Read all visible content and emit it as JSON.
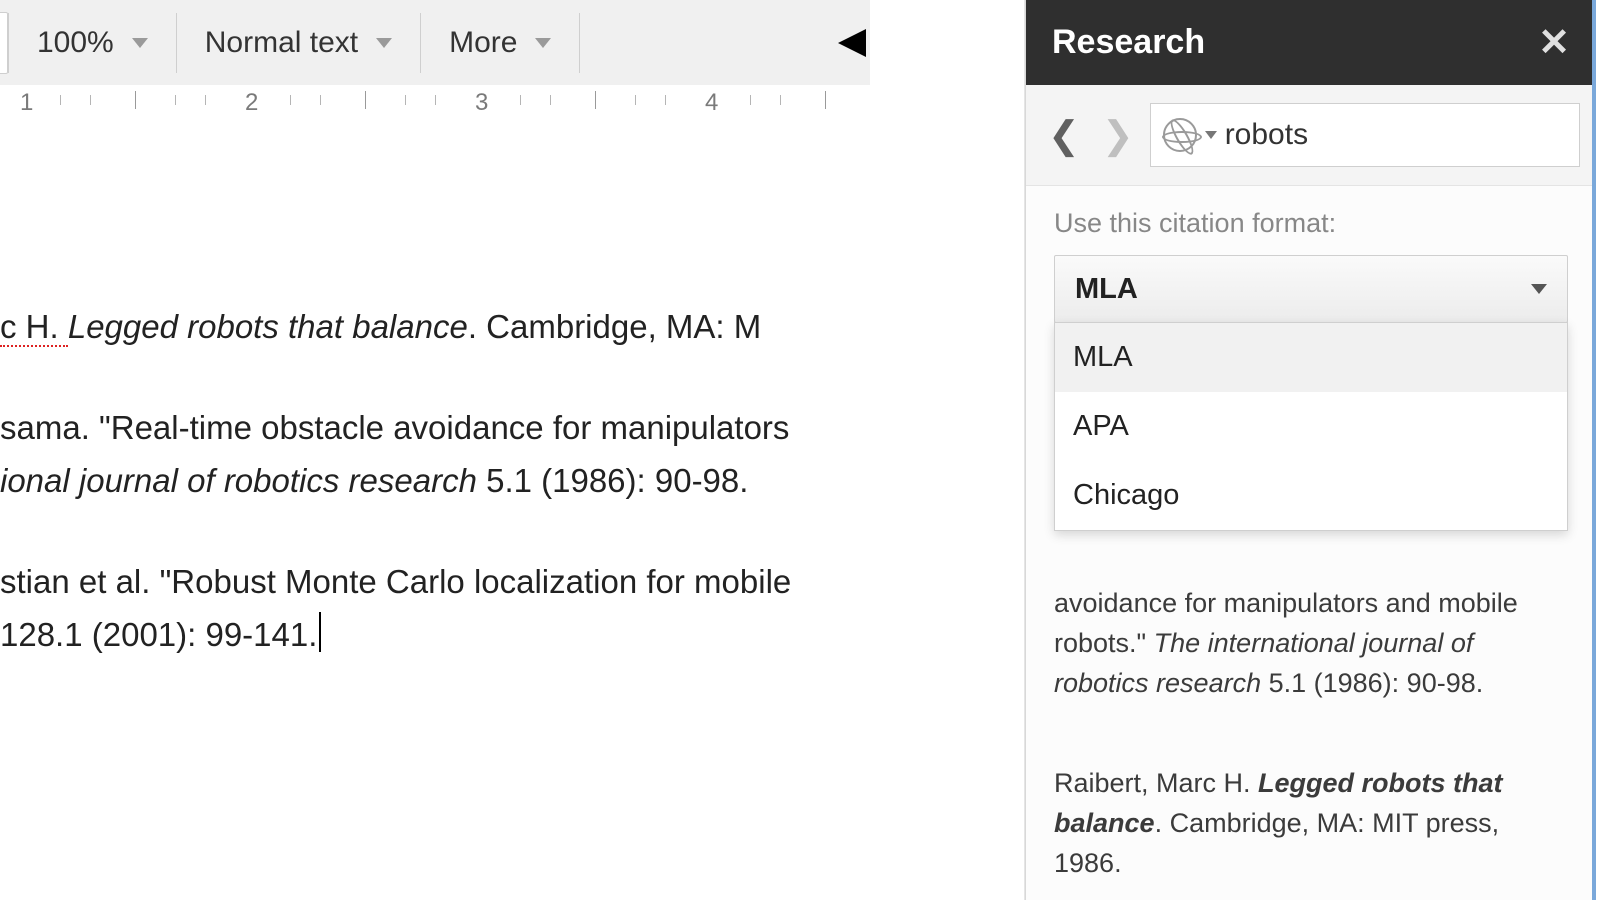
{
  "toolbar": {
    "zoom": "100%",
    "style": "Normal text",
    "more": "More"
  },
  "ruler": {
    "marks": [
      "1",
      "2",
      "3",
      "4"
    ]
  },
  "doc": {
    "p1_a": "c H. ",
    "p1_title": "Legged robots that balance",
    "p1_b": ". Cambridge, MA: M",
    "p2_a": "sama. \"Real-time obstacle avoidance for manipulators",
    "p2_journal": "ional journal of robotics research",
    "p2_b": " 5.1 (1986): 90-98.",
    "p3_a": "stian et al. \"Robust Monte Carlo localization for mobile",
    "p3_b": " 128.1 (2001): 99-141."
  },
  "panel": {
    "title": "Research",
    "search_term": "robots",
    "citation_label": "Use this citation format:",
    "dropdown_selected": "MLA",
    "dropdown_options": [
      "MLA",
      "APA",
      "Chicago"
    ],
    "r1_a": "avoidance for manipulators and mobile robots.\" ",
    "r1_journal": "The international journal of robotics research",
    "r1_b": " 5.1 (1986): 90-98.",
    "r2_a": "Raibert, Marc H. ",
    "r2_title": "Legged robots that balance",
    "r2_b": ". Cambridge, MA: MIT press, 1986."
  }
}
